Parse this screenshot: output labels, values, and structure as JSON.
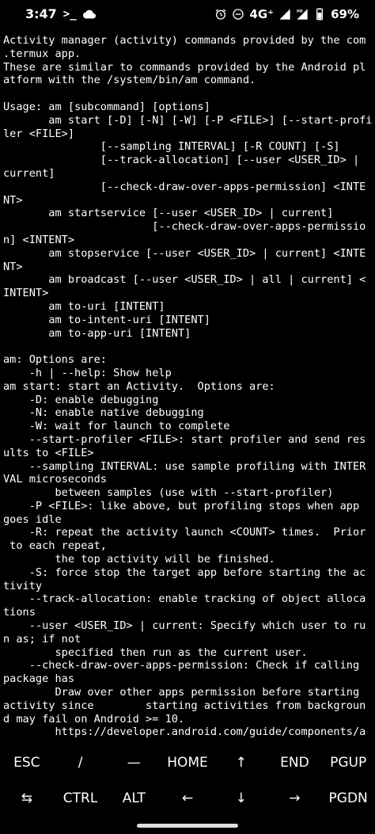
{
  "status_bar": {
    "time": "3:47",
    "terminal_glyph": ">_",
    "network": "4G⁺",
    "battery": "69%",
    "icons": [
      "cloud-icon",
      "alarm-icon",
      "do-not-disturb-icon",
      "signal-icon",
      "hd-signal-icon",
      "battery-icon"
    ]
  },
  "terminal": {
    "lines": [
      "Activity manager (activity) commands provided by the com",
      ".termux app.",
      "These are similar to commands provided by the Android pl",
      "atform with the /system/bin/am command.",
      "",
      "Usage: am [subcommand] [options]",
      "       am start [-D] [-N] [-W] [-P <FILE>] [--start-profi",
      "ler <FILE>]",
      "               [--sampling INTERVAL] [-R COUNT] [-S]",
      "               [--track-allocation] [--user <USER_ID> |",
      "current]",
      "               [--check-draw-over-apps-permission] <INTE",
      "NT>",
      "       am startservice [--user <USER_ID> | current]",
      "                       [--check-draw-over-apps-permissio",
      "n] <INTENT>",
      "       am stopservice [--user <USER_ID> | current] <INTE",
      "NT>",
      "       am broadcast [--user <USER_ID> | all | current] <",
      "INTENT>",
      "       am to-uri [INTENT]",
      "       am to-intent-uri [INTENT]",
      "       am to-app-uri [INTENT]",
      "",
      "am: Options are:",
      "    -h | --help: Show help",
      "am start: start an Activity.  Options are:",
      "    -D: enable debugging",
      "    -N: enable native debugging",
      "    -W: wait for launch to complete",
      "    --start-profiler <FILE>: start profiler and send res",
      "ults to <FILE>",
      "    --sampling INTERVAL: use sample profiling with INTER",
      "VAL microseconds",
      "        between samples (use with --start-profiler)",
      "    -P <FILE>: like above, but profiling stops when app",
      "goes idle",
      "    -R: repeat the activity launch <COUNT> times.  Prior",
      " to each repeat,",
      "        the top activity will be finished.",
      "    -S: force stop the target app before starting the ac",
      "tivity",
      "    --track-allocation: enable tracking of object alloca",
      "tions",
      "    --user <USER_ID> | current: Specify which user to ru",
      "n as; if not",
      "        specified then run as the current user.",
      "    --check-draw-over-apps-permission: Check if calling",
      "package has",
      "        Draw over other apps permission before starting",
      "activity since        starting activities from backgroun",
      "d may fail on Android >= 10.",
      "        https://developer.android.com/guide/components/a"
    ]
  },
  "extra_keys": {
    "row1": [
      {
        "name": "key-esc",
        "label": "ESC"
      },
      {
        "name": "key-slash",
        "label": "/"
      },
      {
        "name": "key-dash",
        "label": "—"
      },
      {
        "name": "key-home",
        "label": "HOME"
      },
      {
        "name": "key-up",
        "label": "↑"
      },
      {
        "name": "key-end",
        "label": "END"
      },
      {
        "name": "key-pgup",
        "label": "PGUP"
      }
    ],
    "row2": [
      {
        "name": "key-tab",
        "label": "⇆"
      },
      {
        "name": "key-ctrl",
        "label": "CTRL"
      },
      {
        "name": "key-alt",
        "label": "ALT"
      },
      {
        "name": "key-left",
        "label": "←"
      },
      {
        "name": "key-down",
        "label": "↓"
      },
      {
        "name": "key-right",
        "label": "→"
      },
      {
        "name": "key-pgdn",
        "label": "PGDN"
      }
    ]
  },
  "colors": {
    "background": "#000000",
    "text": "#ffffff"
  }
}
